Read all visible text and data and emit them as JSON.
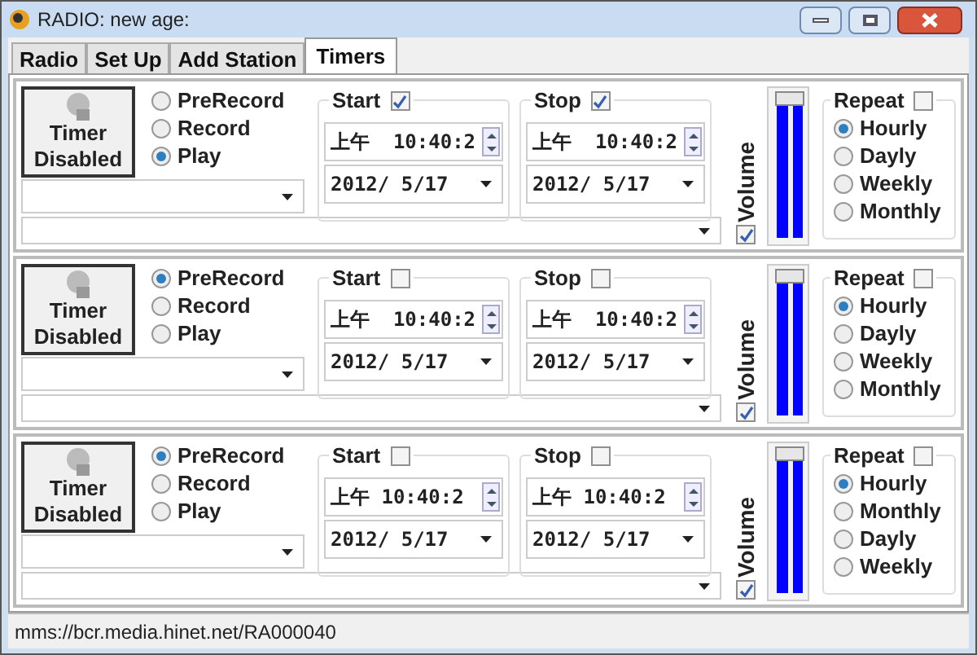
{
  "window": {
    "title": "RADIO: new age:"
  },
  "tabs": [
    {
      "label": "Radio",
      "selected": false
    },
    {
      "label": "Set Up",
      "selected": false
    },
    {
      "label": "Add Station",
      "selected": false
    },
    {
      "label": "Timers",
      "selected": true
    }
  ],
  "timers": [
    {
      "button": "Timer Disabled",
      "modes": [
        {
          "label": "PreRecord",
          "selected": false
        },
        {
          "label": "Record",
          "selected": false
        },
        {
          "label": "Play",
          "selected": true
        }
      ],
      "start": {
        "label": "Start",
        "checked": true,
        "time": "上午  10:40:2",
        "date": "2012/ 5/17"
      },
      "stop": {
        "label": "Stop",
        "checked": true,
        "time": "上午  10:40:2",
        "date": "2012/ 5/17"
      },
      "volume": {
        "label": "Volume",
        "checked": true,
        "level": 1
      },
      "repeat": {
        "label": "Repeat",
        "checked": false,
        "options": [
          {
            "label": "Hourly",
            "selected": true
          },
          {
            "label": "Dayly",
            "selected": false
          },
          {
            "label": "Weekly",
            "selected": false
          },
          {
            "label": "Monthly",
            "selected": false
          }
        ]
      }
    },
    {
      "button": "Timer Disabled",
      "modes": [
        {
          "label": "PreRecord",
          "selected": true
        },
        {
          "label": "Record",
          "selected": false
        },
        {
          "label": "Play",
          "selected": false
        }
      ],
      "start": {
        "label": "Start",
        "checked": false,
        "time": "上午  10:40:2",
        "date": "2012/ 5/17"
      },
      "stop": {
        "label": "Stop",
        "checked": false,
        "time": "上午  10:40:2",
        "date": "2012/ 5/17"
      },
      "volume": {
        "label": "Volume",
        "checked": true,
        "level": 1
      },
      "repeat": {
        "label": "Repeat",
        "checked": false,
        "options": [
          {
            "label": "Hourly",
            "selected": true
          },
          {
            "label": "Dayly",
            "selected": false
          },
          {
            "label": "Weekly",
            "selected": false
          },
          {
            "label": "Monthly",
            "selected": false
          }
        ]
      }
    },
    {
      "button": "Timer Disabled",
      "modes": [
        {
          "label": "PreRecord",
          "selected": true
        },
        {
          "label": "Record",
          "selected": false
        },
        {
          "label": "Play",
          "selected": false
        }
      ],
      "start": {
        "label": "Start",
        "checked": false,
        "time": "上午 10:40:2",
        "date": "2012/ 5/17"
      },
      "stop": {
        "label": "Stop",
        "checked": false,
        "time": "上午 10:40:2",
        "date": "2012/ 5/17"
      },
      "volume": {
        "label": "Volume",
        "checked": true,
        "level": 1
      },
      "repeat": {
        "label": "Repeat",
        "checked": false,
        "options": [
          {
            "label": "Hourly",
            "selected": true
          },
          {
            "label": "Monthly",
            "selected": false
          },
          {
            "label": "Dayly",
            "selected": false
          },
          {
            "label": "Weekly",
            "selected": false
          }
        ]
      }
    }
  ],
  "status_bar": "mms://bcr.media.hinet.net/RA000040"
}
